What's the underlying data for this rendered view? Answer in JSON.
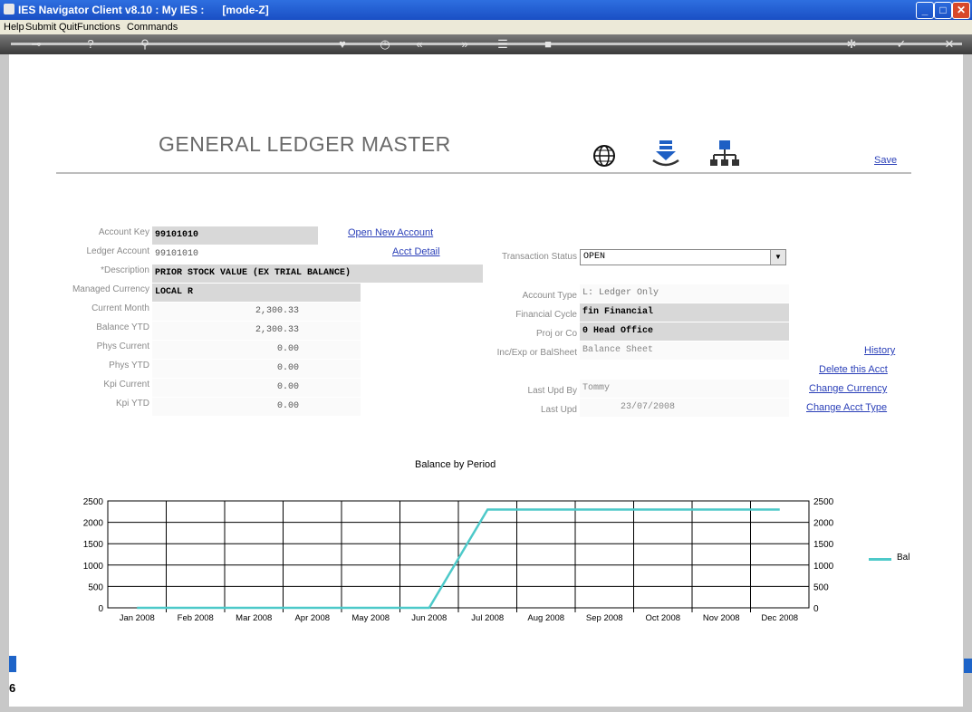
{
  "window": {
    "title": "IES Navigator Client v8.10 : My IES :      [mode-Z]"
  },
  "menu": [
    "Help",
    "Submit",
    "Quit",
    "Functions",
    "Commands"
  ],
  "page": {
    "title": "GENERAL LEDGER MASTER",
    "save_label": "Save"
  },
  "links": {
    "open_new_account": "Open New Account",
    "acct_detail": "Acct Detail",
    "history": "History",
    "delete_acct": "Delete this Acct",
    "change_currency": "Change Currency",
    "change_acct_type": "Change Acct Type"
  },
  "left_fields": [
    {
      "label": "Account Key",
      "value": "99101010"
    },
    {
      "label": "Ledger Account",
      "value": "99101010"
    },
    {
      "label": "*Description",
      "value": "PRIOR STOCK VALUE (EX TRIAL BALANCE)"
    },
    {
      "label": "Managed Currency",
      "value": "LOCAL R"
    },
    {
      "label": "Current Month",
      "value": "2,300.33"
    },
    {
      "label": "Balance YTD",
      "value": "2,300.33"
    },
    {
      "label": "Phys Current",
      "value": "0.00"
    },
    {
      "label": "Phys YTD",
      "value": "0.00"
    },
    {
      "label": "Kpi Current",
      "value": "0.00"
    },
    {
      "label": "Kpi YTD",
      "value": "0.00"
    }
  ],
  "right_fields": [
    {
      "label": "Transaction Status",
      "value": "OPEN"
    },
    {
      "label": "Account Type",
      "value": "L: Ledger Only"
    },
    {
      "label": "Financial Cycle",
      "value": "fin Financial"
    },
    {
      "label": "Proj or Co",
      "value": "0 Head Office"
    },
    {
      "label": "Inc/Exp or BalSheet",
      "value": "Balance Sheet"
    },
    {
      "label": "Last Upd By",
      "value": "Tommy"
    },
    {
      "label": "Last Upd",
      "value": "23/07/2008"
    }
  ],
  "side_tab": {
    "label": "6"
  },
  "chart_data": {
    "type": "line",
    "title": "Balance by Period",
    "categories": [
      "Jan 2008",
      "Feb 2008",
      "Mar 2008",
      "Apr 2008",
      "May 2008",
      "Jun 2008",
      "Jul 2008",
      "Aug 2008",
      "Sep 2008",
      "Oct 2008",
      "Nov 2008",
      "Dec 2008"
    ],
    "series": [
      {
        "name": "Bal",
        "values": [
          0,
          0,
          0,
          0,
          0,
          0,
          2300,
          2300,
          2300,
          2300,
          2300,
          2300
        ],
        "color": "#4dc9c9"
      }
    ],
    "ylim": [
      0,
      2500
    ],
    "yticks": [
      "0",
      "500",
      "1000",
      "1500",
      "2000",
      "2500"
    ],
    "grid": true,
    "legend": "right"
  }
}
